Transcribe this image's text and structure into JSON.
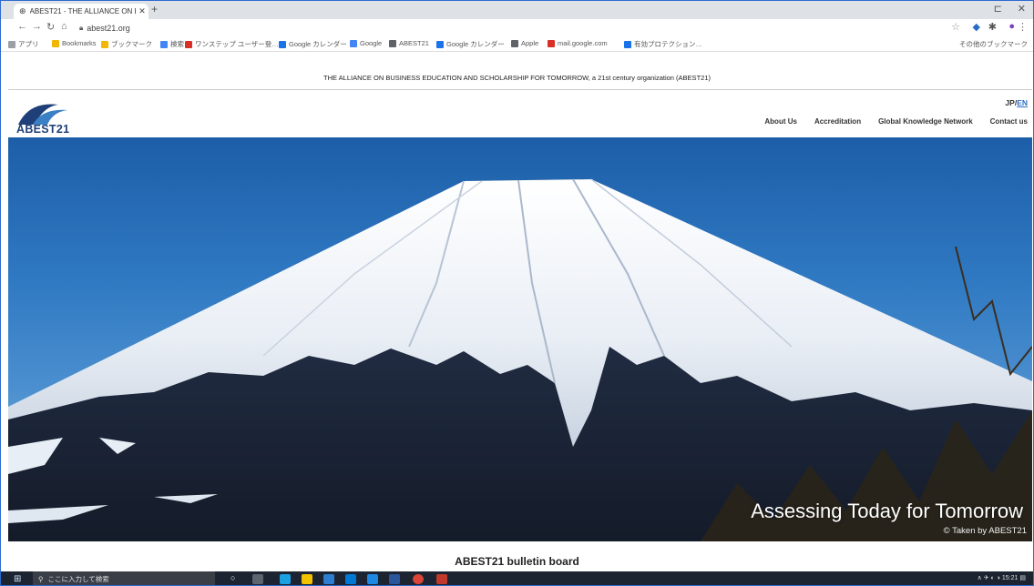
{
  "browser": {
    "tab_title": "ABEST21 - THE ALLIANCE ON B",
    "tab_close": "✕",
    "new_tab": "+",
    "window_controls": {
      "restore": "⊏",
      "close": "✕"
    },
    "url": "abest21.org",
    "bookmarks": [
      {
        "label": "アプリ",
        "color": "#9aa0a6"
      },
      {
        "label": "Bookmarks",
        "color": "#f2b705"
      },
      {
        "label": "ブックマーク",
        "color": "#f2b705"
      },
      {
        "label": "検索",
        "color": "#4285f4"
      },
      {
        "label": "ワンステップ ユーザー登…",
        "color": "#d93025"
      },
      {
        "label": "Google カレンダー",
        "color": "#1a73e8"
      },
      {
        "label": "Google",
        "color": "#4285f4"
      },
      {
        "label": "ABEST21",
        "color": "#5f6368"
      },
      {
        "label": "Google カレンダー",
        "color": "#1a73e8"
      },
      {
        "label": "Apple",
        "color": "#5f6368"
      },
      {
        "label": "mail.google.com",
        "color": "#d93025"
      },
      {
        "label": "有効プロテクション…",
        "color": "#1a73e8"
      }
    ],
    "other_bookmarks": "その他のブックマーク"
  },
  "page": {
    "announcement": "THE ALLIANCE ON BUSINESS EDUCATION AND SCHOLARSHIP FOR TOMORROW, a 21st century organization (ABEST21)",
    "logo_text": "ABEST21",
    "lang_jp": "JP",
    "lang_sep": "/",
    "lang_en": "EN",
    "nav": [
      "About Us",
      "Accreditation",
      "Global Knowledge Network",
      "Contact us"
    ],
    "hero_caption": "Assessing Today for Tomorrow",
    "hero_credit": "© Taken by ABEST21",
    "bulletin_title": "ABEST21 bulletin board"
  },
  "taskbar": {
    "search_placeholder": "ここに入力して検索",
    "clock": "15:21"
  },
  "colors": {
    "accent": "#1f3f78",
    "link": "#2b6cc4",
    "taskbar": "#1b2430"
  }
}
